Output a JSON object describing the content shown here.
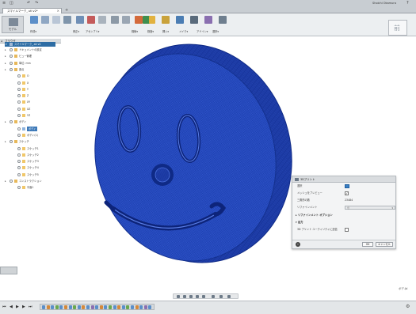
{
  "window": {
    "title_buttons": [
      "≡",
      "◫",
      "↶",
      "↷"
    ],
    "user": "Shoichi Okamura",
    "help": "?"
  },
  "tabs": [
    {
      "label": "スマイルマーク_.stl v2*",
      "close": "×"
    }
  ],
  "tab_add": "+",
  "workspace": {
    "label": "モデル"
  },
  "toolbar_groups": [
    {
      "label": "作成▾"
    },
    {
      "label": "修正▾"
    },
    {
      "label": "アセンブリ▾"
    },
    {
      "label": "構築▾"
    },
    {
      "label": "検査▾"
    },
    {
      "label": "挿入▾"
    },
    {
      "label": "メイク▾"
    },
    {
      "label": "アドイン▾"
    },
    {
      "label": "選択▾"
    }
  ],
  "viewcube": {
    "label": "前"
  },
  "browser": {
    "header": "ブラウザ",
    "root": "スマイルマーク_.stl v2",
    "items": [
      {
        "label": "ドキュメントの設定",
        "indent": 1
      },
      {
        "label": "ビュー管理",
        "indent": 1
      },
      {
        "label": "単位: mm",
        "indent": 1
      },
      {
        "label": "原点",
        "indent": 1
      },
      {
        "label": "O",
        "indent": 2
      },
      {
        "label": "X",
        "indent": 2
      },
      {
        "label": "Y",
        "indent": 2
      },
      {
        "label": "Z",
        "indent": 2
      },
      {
        "label": "XY",
        "indent": 2
      },
      {
        "label": "XZ",
        "indent": 2
      },
      {
        "label": "YZ",
        "indent": 2
      },
      {
        "label": "ボディ",
        "indent": 1
      },
      {
        "label": "ボディ",
        "indent": 2,
        "selected": true
      },
      {
        "label": "ボディ(1)",
        "indent": 2
      },
      {
        "label": "スケッチ",
        "indent": 1
      },
      {
        "label": "スケッチ1",
        "indent": 2
      },
      {
        "label": "スケッチ2",
        "indent": 2
      },
      {
        "label": "スケッチ3",
        "indent": 2
      },
      {
        "label": "スケッチ4",
        "indent": 2
      },
      {
        "label": "スケッチ5",
        "indent": 2
      },
      {
        "label": "コンストラクション",
        "indent": 1
      },
      {
        "label": "平面1",
        "indent": 2
      }
    ]
  },
  "palette": {
    "title": "3Dプリント",
    "rows": [
      {
        "label": "選択",
        "control": "selection"
      },
      {
        "label": "メッシュをプレビュー",
        "control": "checkbox",
        "checked": true
      },
      {
        "label": "三角形の数",
        "value": "23484"
      },
      {
        "label": "リファインメント",
        "control": "dropdown",
        "value": "低"
      }
    ],
    "section_refinement": "リファインメント オプション",
    "section_output": "出力",
    "output_row": "3D プリント ユーティリティに送信",
    "ok": "OK",
    "cancel": "キャンセル",
    "info": "i"
  },
  "status": {
    "body_tag": "ボディ"
  },
  "timeline": {
    "controls": [
      "⏮",
      "◀",
      "▶",
      "▶",
      "⏭"
    ],
    "gear": "⚙"
  },
  "colors": {
    "mesh_blue": "#1c3fb0",
    "selection_blue": "#3b7fc4",
    "toolbar_bg": "#eceff1"
  }
}
